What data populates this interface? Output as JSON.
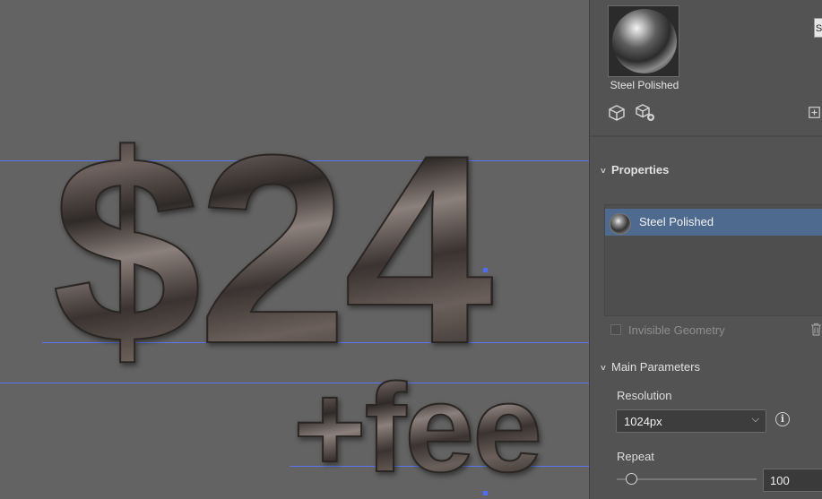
{
  "canvas": {
    "line1": "$24",
    "line2": "+fee"
  },
  "panel": {
    "material_label": "Steel Polished",
    "tooltip_tab": "S",
    "icons": [
      "cube-icon",
      "cube-add-icon",
      "plus-square-icon"
    ],
    "properties": {
      "title": "Properties",
      "selected_item": "Steel Polished",
      "invisible_geometry_label": "Invisible Geometry",
      "invisible_geometry_checked": false
    },
    "main_parameters": {
      "title": "Main Parameters",
      "resolution_label": "Resolution",
      "resolution_value": "1024px",
      "repeat_label": "Repeat",
      "repeat_value": "100"
    }
  }
}
